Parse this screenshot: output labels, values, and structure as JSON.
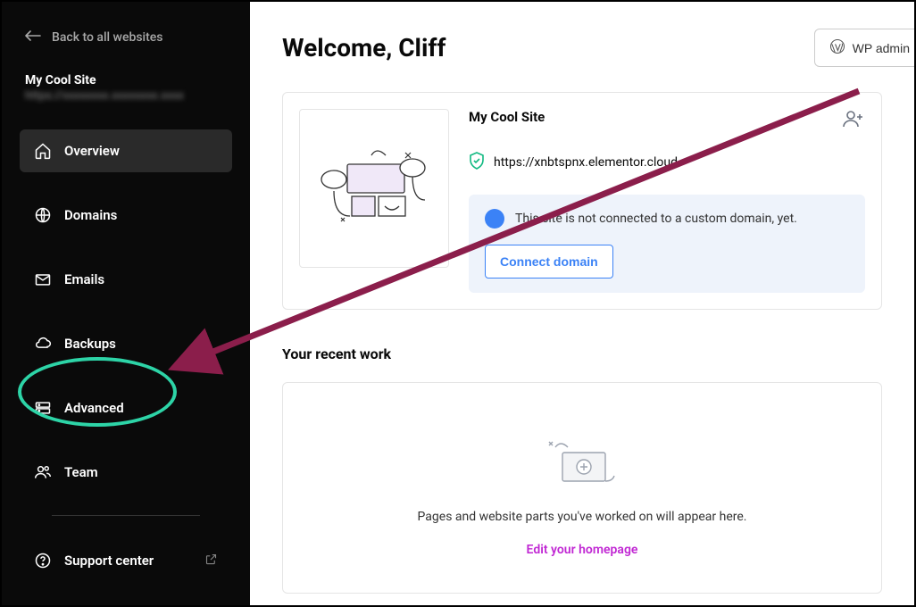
{
  "sidebar": {
    "back_label": "Back to all websites",
    "site_name": "My Cool Site",
    "site_url_masked": "https://xxxxxxxx.xxxxxxxx.xxxx",
    "items": [
      {
        "label": "Overview",
        "name": "overview",
        "active": true
      },
      {
        "label": "Domains",
        "name": "domains",
        "active": false
      },
      {
        "label": "Emails",
        "name": "emails",
        "active": false
      },
      {
        "label": "Backups",
        "name": "backups",
        "active": false
      },
      {
        "label": "Advanced",
        "name": "advanced",
        "active": false
      },
      {
        "label": "Team",
        "name": "team",
        "active": false
      }
    ],
    "support_label": "Support center"
  },
  "header": {
    "welcome": "Welcome, Cliff",
    "wp_admin_label": "WP admin"
  },
  "site_card": {
    "title": "My Cool Site",
    "url": "https://xnbtspnx.elementor.cloud",
    "notice_text": "This site is not connected to a custom domain, yet.",
    "connect_label": "Connect domain"
  },
  "recent": {
    "title": "Your recent work",
    "empty_text": "Pages and website parts you've worked on will appear here.",
    "edit_link": "Edit your homepage"
  },
  "annotation": {
    "highlight_target": "advanced",
    "arrow_color": "#8b1e4b"
  }
}
